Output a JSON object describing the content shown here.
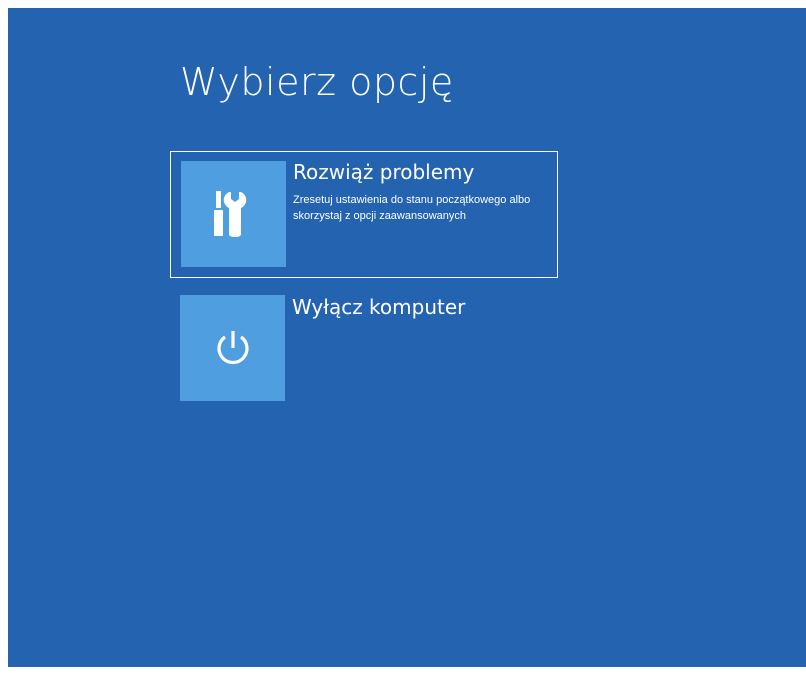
{
  "page": {
    "title": "Wybierz opcję"
  },
  "options": [
    {
      "title": "Rozwiąż problemy",
      "description": "Zresetuj ustawienia do stanu początkowego albo skorzystaj z opcji zaawansowanych",
      "icon": "troubleshoot-tools-icon",
      "selected": true
    },
    {
      "title": "Wyłącz komputer",
      "icon": "power-icon",
      "selected": false
    }
  ],
  "colors": {
    "background": "#2463b0",
    "tile": "#4f9fe0",
    "text": "#ffffff"
  }
}
